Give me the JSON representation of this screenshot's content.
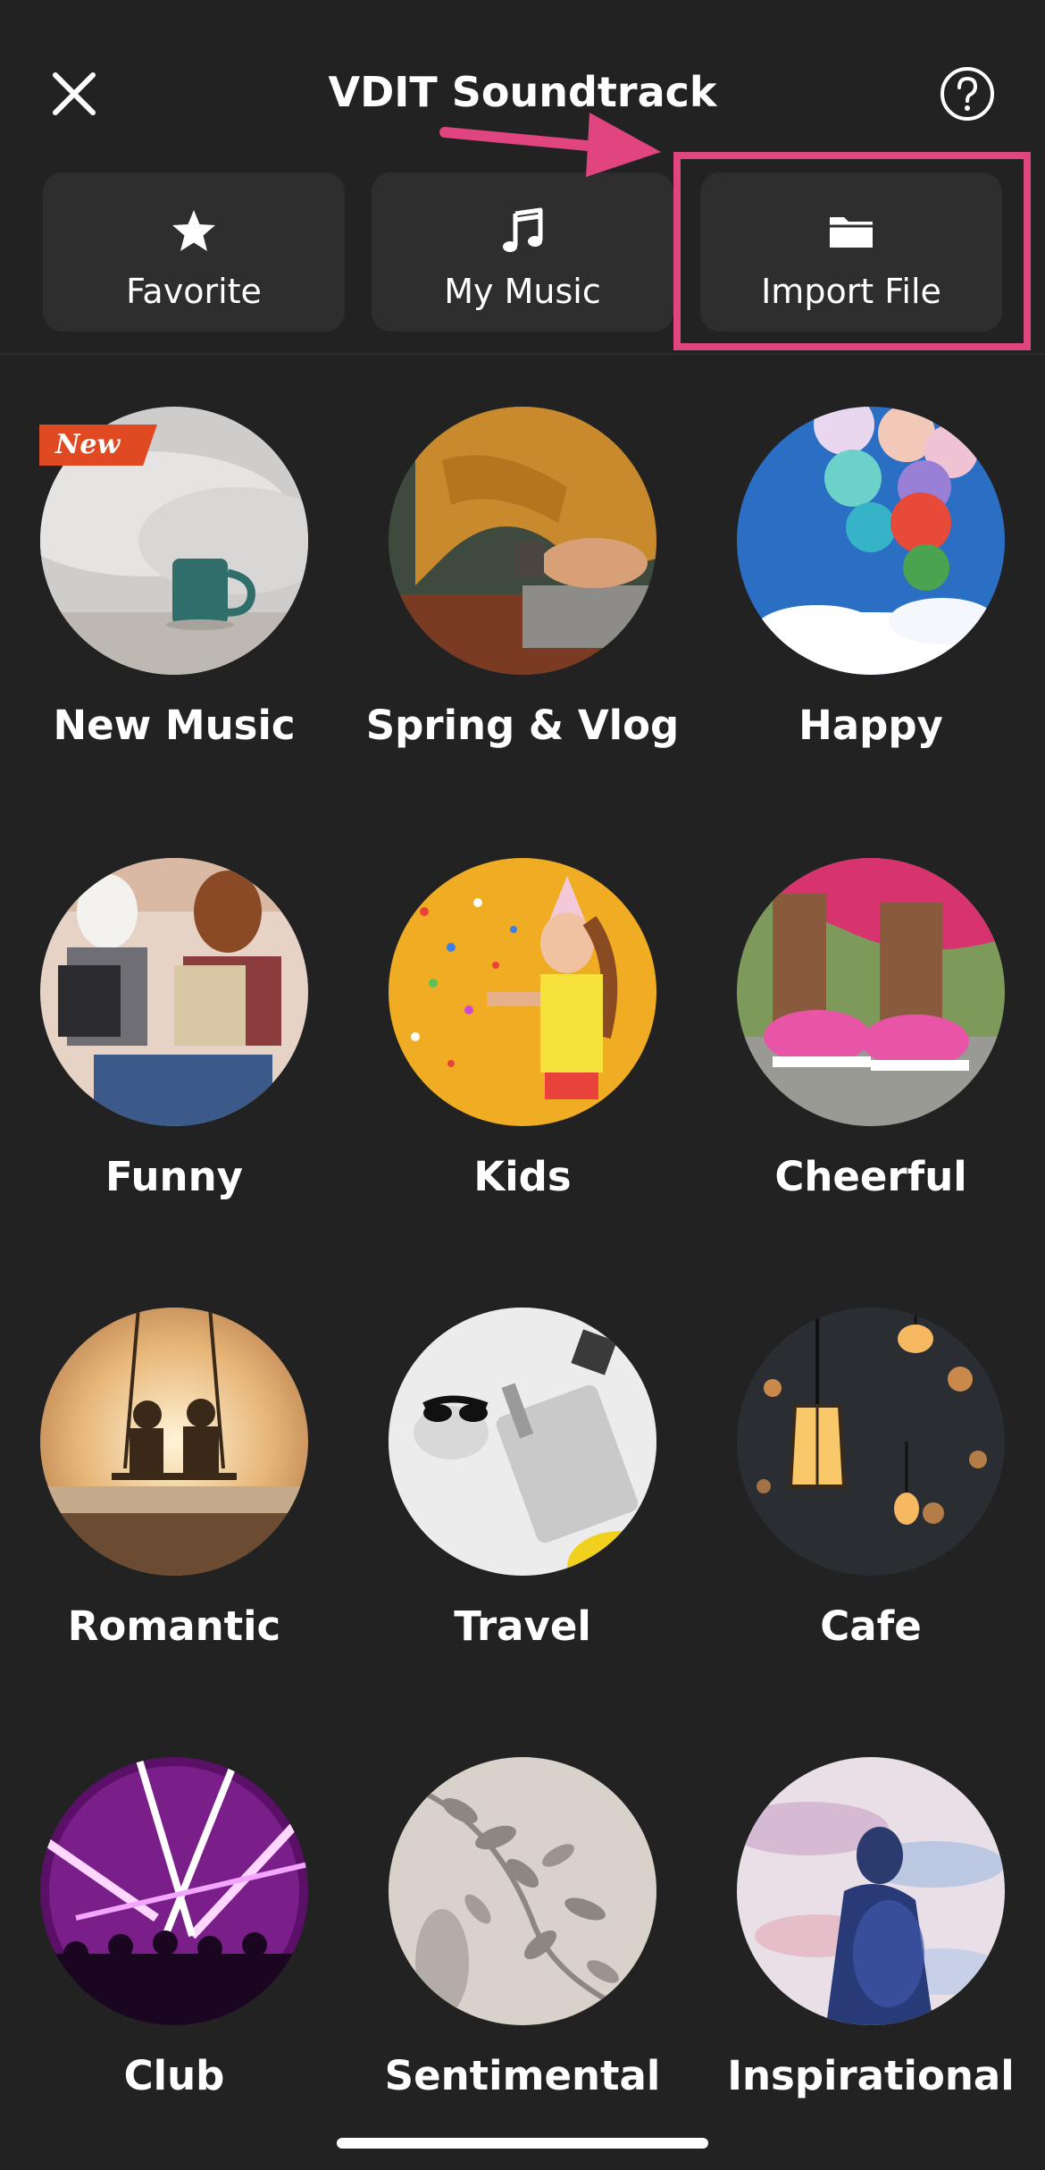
{
  "header": {
    "title": "VDIT Soundtrack",
    "close_icon": "close-icon",
    "help_icon": "question-circle-icon"
  },
  "tabs": [
    {
      "label": "Favorite",
      "icon": "star-icon"
    },
    {
      "label": "My Music",
      "icon": "music-note-icon"
    },
    {
      "label": "Import File",
      "icon": "folder-icon"
    }
  ],
  "annotation": {
    "highlight_color": "#e0457f",
    "highlighted_tab": "Import File"
  },
  "badge": {
    "text": "New",
    "color": "#e04a23"
  },
  "categories": [
    {
      "label": "New Music"
    },
    {
      "label": "Spring & Vlog"
    },
    {
      "label": "Happy"
    },
    {
      "label": "Funny"
    },
    {
      "label": "Kids"
    },
    {
      "label": "Cheerful"
    },
    {
      "label": "Romantic"
    },
    {
      "label": "Travel"
    },
    {
      "label": "Cafe"
    },
    {
      "label": "Club"
    },
    {
      "label": "Sentimental"
    },
    {
      "label": "Inspirational"
    }
  ],
  "colors": {
    "background": "#222222",
    "tab_background": "#2e2e2e",
    "text": "#ffffff"
  }
}
